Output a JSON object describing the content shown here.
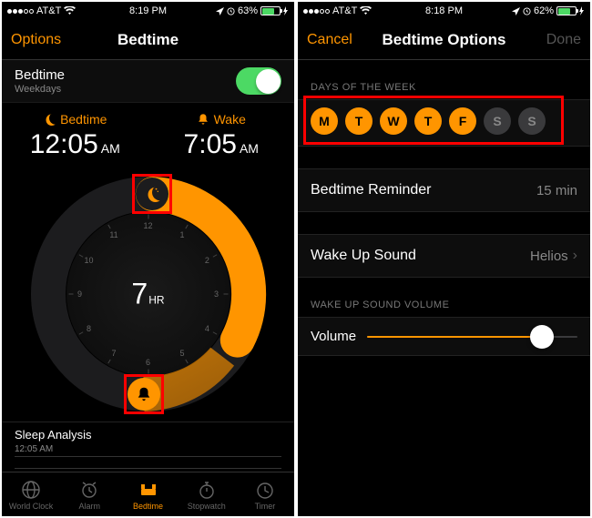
{
  "left": {
    "status": {
      "carrier": "AT&T",
      "time": "8:19 PM",
      "battery": "63%",
      "battery_pct": 63
    },
    "nav": {
      "left": "Options",
      "title": "Bedtime"
    },
    "schedule": {
      "title": "Bedtime",
      "subtitle": "Weekdays"
    },
    "bedtime": {
      "label": "Bedtime",
      "time": "12:05",
      "ampm": "AM"
    },
    "wake": {
      "label": "Wake",
      "time": "7:05",
      "ampm": "AM"
    },
    "duration_num": "7",
    "duration_unit": "HR",
    "face_labels": [
      "12",
      "1",
      "2",
      "3",
      "4",
      "5",
      "6",
      "7",
      "8",
      "9",
      "10",
      "11"
    ],
    "sleep": {
      "title": "Sleep Analysis",
      "time": "12:05 AM"
    },
    "tabs": [
      {
        "label": "World Clock"
      },
      {
        "label": "Alarm"
      },
      {
        "label": "Bedtime"
      },
      {
        "label": "Stopwatch"
      },
      {
        "label": "Timer"
      }
    ]
  },
  "right": {
    "status": {
      "carrier": "AT&T",
      "time": "8:18 PM",
      "battery": "62%",
      "battery_pct": 62
    },
    "nav": {
      "left": "Cancel",
      "title": "Bedtime Options",
      "right": "Done"
    },
    "days_header": "DAYS OF THE WEEK",
    "days": [
      {
        "l": "M",
        "on": true
      },
      {
        "l": "T",
        "on": true
      },
      {
        "l": "W",
        "on": true
      },
      {
        "l": "T",
        "on": true
      },
      {
        "l": "F",
        "on": true
      },
      {
        "l": "S",
        "on": false
      },
      {
        "l": "S",
        "on": false
      }
    ],
    "reminder": {
      "label": "Bedtime Reminder",
      "value": "15 min"
    },
    "sound": {
      "label": "Wake Up Sound",
      "value": "Helios"
    },
    "volume_header": "WAKE UP SOUND VOLUME",
    "volume_label": "Volume"
  }
}
